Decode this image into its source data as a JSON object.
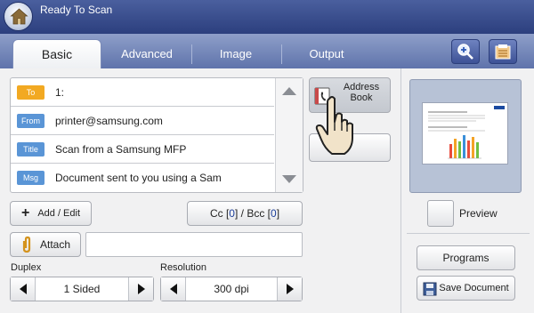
{
  "header": {
    "title": "Ready To Scan"
  },
  "tabs": [
    {
      "label": "Basic",
      "active": true
    },
    {
      "label": "Advanced",
      "active": false
    },
    {
      "label": "Image",
      "active": false
    },
    {
      "label": "Output",
      "active": false
    }
  ],
  "fields": [
    {
      "badge": "To",
      "value": "1:"
    },
    {
      "badge": "From",
      "value": "printer@samsung.com"
    },
    {
      "badge": "Title",
      "value": "Scan from a Samsung MFP"
    },
    {
      "badge": "Msg",
      "value": "Document sent to you using a Sam"
    }
  ],
  "buttons": {
    "address_book_line1": "Address",
    "address_book_line2": "Book",
    "add_edit": "Add / Edit",
    "cc_prefix": "Cc [",
    "cc_count": "0",
    "cc_mid": "] / Bcc [",
    "bcc_count": "0",
    "cc_suffix": "]",
    "attach": "Attach",
    "preview": "Preview",
    "programs": "Programs",
    "save_document": "Save Document"
  },
  "duplex": {
    "label": "Duplex",
    "value": "1 Sided"
  },
  "resolution": {
    "label": "Resolution",
    "value": "300 dpi"
  },
  "colors": {
    "header": "#2c3f7e",
    "tab_bar": "#7284b8",
    "badge_to": "#f2a922",
    "badge_blue": "#5a95d6"
  },
  "icons": [
    "home-icon",
    "zoom-icon",
    "settings-list-icon",
    "plus-icon",
    "paperclip-icon",
    "address-book-icon",
    "hand-pointer-icon",
    "floppy-disk-icon"
  ]
}
